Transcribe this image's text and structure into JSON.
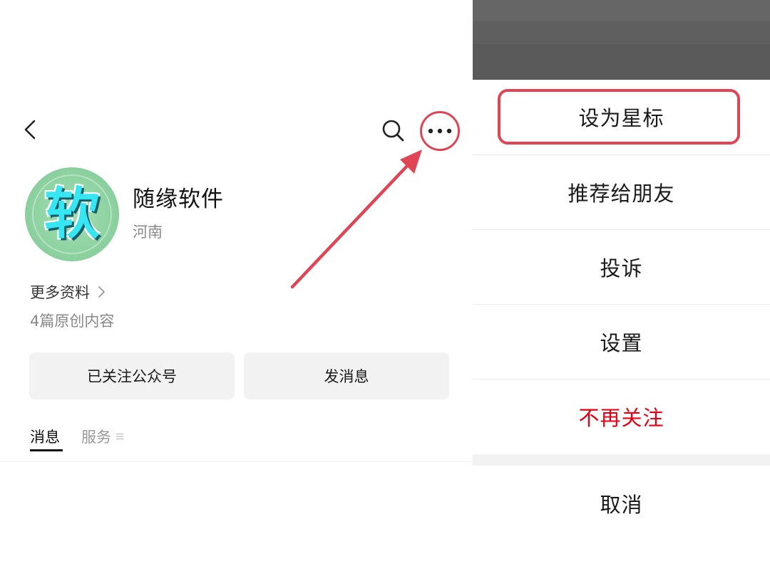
{
  "profile": {
    "name": "随缘软件",
    "region": "河南",
    "avatar_glyph": "软",
    "more_info_label": "更多资料",
    "original_count": "4篇原创内容"
  },
  "actions": {
    "followed_label": "已关注公众号",
    "message_label": "发消息"
  },
  "tabs": {
    "messages": "消息",
    "services": "服务"
  },
  "icons": {
    "back": "chevron-left-icon",
    "search": "search-icon",
    "more": "more-dots-icon"
  },
  "action_sheet": {
    "items": [
      "设为星标",
      "推荐给朋友",
      "投诉",
      "设置",
      "不再关注"
    ],
    "cancel": "取消"
  },
  "colors": {
    "highlight": "#e04556",
    "danger": "#e60012",
    "button_bg": "#f2f2f2"
  }
}
